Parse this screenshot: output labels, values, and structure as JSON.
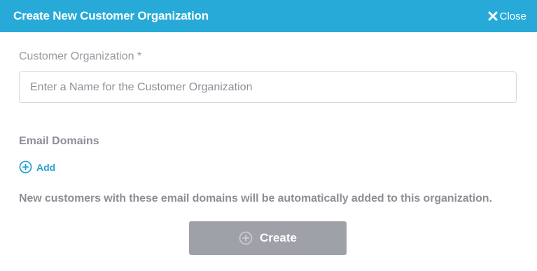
{
  "modal": {
    "title": "Create New Customer Organization",
    "close_label": "Close"
  },
  "form": {
    "organization_label": "Customer Organization *",
    "organization_placeholder": "Enter a Name for the Customer Organization",
    "organization_value": "",
    "email_domains_label": "Email Domains",
    "add_label": "Add",
    "help_text": "New customers with these email domains will be automatically added to this organization.",
    "create_label": "Create"
  },
  "colors": {
    "header": "#27aad8",
    "link": "#27a0cf",
    "button_disabled": "#9ea1a7",
    "label_text": "#8c8f96"
  },
  "icons": {
    "close": "close-icon",
    "add": "plus-circle-icon",
    "create": "plus-circle-icon"
  }
}
